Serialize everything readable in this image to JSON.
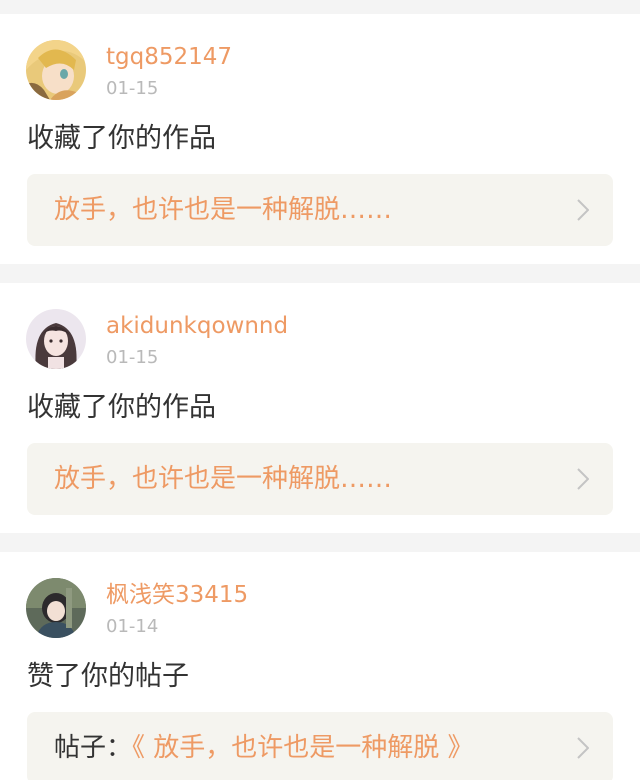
{
  "notifications": [
    {
      "username": "tgq852147",
      "date": "01-15",
      "action": "收藏了你的作品",
      "ref_prefix": "",
      "ref_title": "放手，也许也是一种解脱……",
      "avatar_icon": "anime-avatar"
    },
    {
      "username": "akidunkqownnd",
      "date": "01-15",
      "action": "收藏了你的作品",
      "ref_prefix": "",
      "ref_title": "放手，也许也是一种解脱……",
      "avatar_icon": "girl-avatar"
    },
    {
      "username": "枫浅笑33415",
      "date": "01-14",
      "action": "赞了你的帖子",
      "ref_prefix": "帖子：",
      "ref_title": "《 放手，也许也是一种解脱 》",
      "avatar_icon": "child-avatar"
    }
  ],
  "colors": {
    "accent": "#ee9a64",
    "ref_background": "#f5f4ef",
    "time_gray": "#b9b9b9"
  }
}
